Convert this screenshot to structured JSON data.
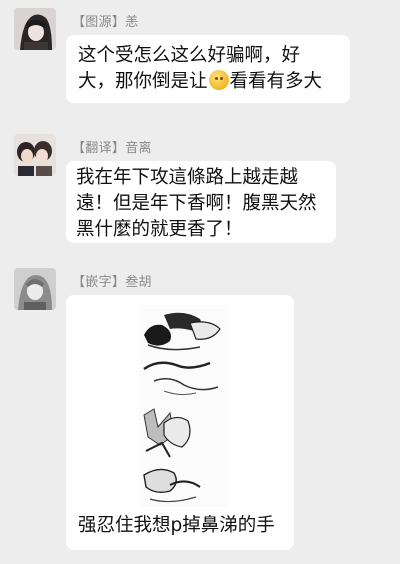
{
  "messages": [
    {
      "sender": "【图源】恙",
      "lines": [
        "这个受怎么这么好骗啊，好",
        "大，那你倒是让",
        "看看有多大"
      ],
      "emoji_icon": "smiling-face-emoji"
    },
    {
      "sender": "【翻译】音离",
      "lines": [
        "我在年下攻這條路上越走越",
        "遠！但是年下香啊！腹黑天然",
        "黑什麼的就更香了！"
      ]
    },
    {
      "sender": "【嵌字】叁胡",
      "sticker_icon": "manga-sticker-image",
      "caption": "强忍住我想p掉鼻涕的手"
    }
  ]
}
